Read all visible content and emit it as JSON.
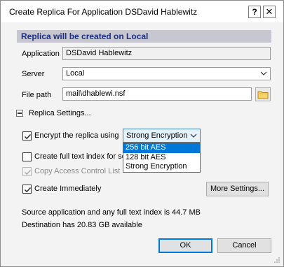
{
  "dialog": {
    "title": "Create Replica For Application DSDavid Hablewitz",
    "help_glyph": "?",
    "close_glyph": "✕",
    "banner": "Replica will be created on Local"
  },
  "form": {
    "application_label": "Application",
    "application_value": "DSDavid Hablewitz",
    "server_label": "Server",
    "server_value": "Local",
    "filepath_label": "File path",
    "filepath_value": "mail\\dhablewi.nsf"
  },
  "replica_settings": {
    "section_label": "Replica Settings...",
    "encrypt": {
      "label": "Encrypt the replica using",
      "checked": true
    },
    "encryption_selected": "Strong Encryption",
    "encryption_options": [
      "256 bit AES",
      "128 bit AES",
      "Strong Encryption"
    ],
    "highlighted_option": "256 bit AES",
    "fulltext": {
      "label": "Create full text index for sea",
      "checked": false
    },
    "acl": {
      "label": "Copy Access Control List",
      "checked": true,
      "disabled": true
    },
    "immediately": {
      "label": "Create Immediately",
      "checked": true
    },
    "more_settings_label": "More Settings..."
  },
  "info": {
    "size_line": "Source application and any full text index is 44.7 MB",
    "dest_line": "Destination has 20.83 GB available"
  },
  "buttons": {
    "ok": "OK",
    "cancel": "Cancel"
  },
  "colors": {
    "banner_bg": "#c7c7d1",
    "banner_text": "#1c2f82",
    "selection": "#0078d7",
    "combo_focus_bg": "#e5f1fb"
  },
  "icons": [
    "help-icon",
    "close-icon",
    "chevron-down-icon",
    "folder-icon",
    "collapse-icon",
    "checkmark-icon",
    "resize-grip-icon"
  ]
}
